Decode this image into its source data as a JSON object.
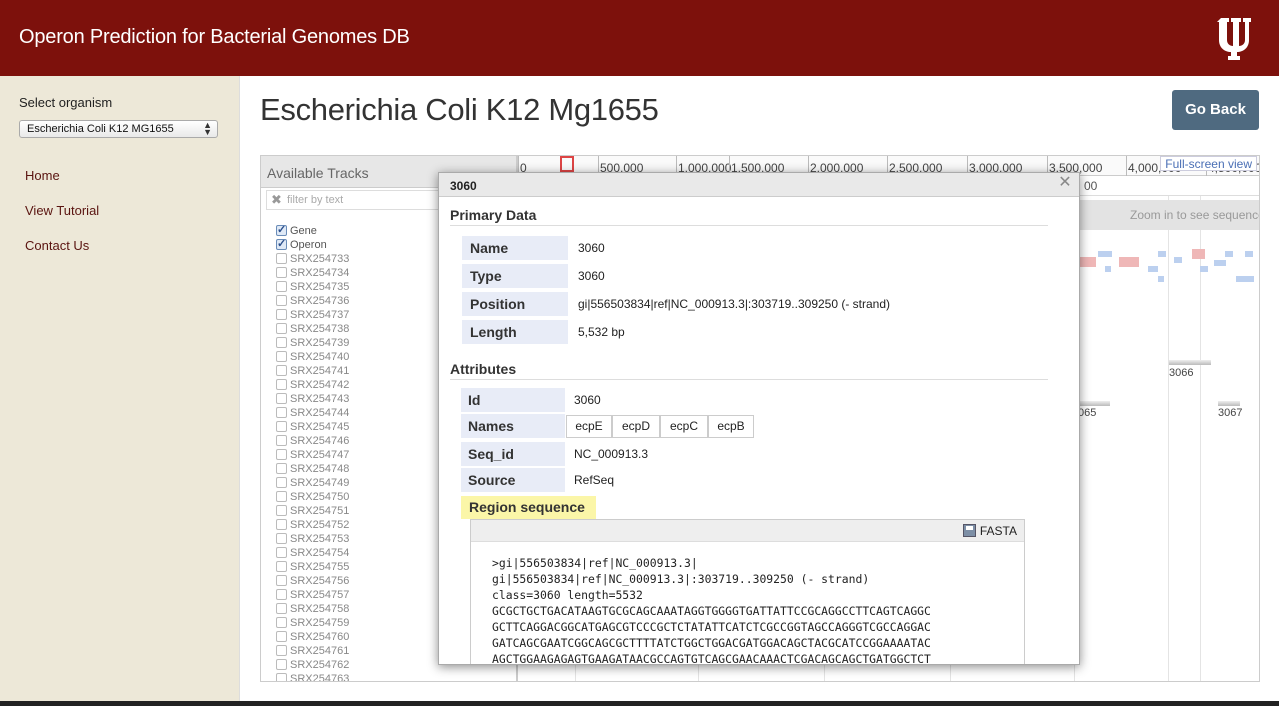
{
  "header": {
    "title": "Operon Prediction for Bacterial Genomes DB",
    "logo": "indiana-university-trident"
  },
  "sidebar": {
    "select_label": "Select organism",
    "selected_organism": "Escherichia Coli K12 MG1655",
    "nav": [
      "Home",
      "View Tutorial",
      "Contact Us"
    ]
  },
  "main": {
    "title": "Escherichia Coli K12 Mg1655",
    "go_back": "Go Back"
  },
  "tracks": {
    "header": "Available Tracks",
    "filter_placeholder": "filter by text",
    "items": [
      {
        "label": "Gene",
        "checked": true
      },
      {
        "label": "Operon",
        "checked": true
      },
      {
        "label": "SRX254733",
        "checked": false
      },
      {
        "label": "SRX254734",
        "checked": false
      },
      {
        "label": "SRX254735",
        "checked": false
      },
      {
        "label": "SRX254736",
        "checked": false
      },
      {
        "label": "SRX254737",
        "checked": false
      },
      {
        "label": "SRX254738",
        "checked": false
      },
      {
        "label": "SRX254739",
        "checked": false
      },
      {
        "label": "SRX254740",
        "checked": false
      },
      {
        "label": "SRX254741",
        "checked": false
      },
      {
        "label": "SRX254742",
        "checked": false
      },
      {
        "label": "SRX254743",
        "checked": false
      },
      {
        "label": "SRX254744",
        "checked": false
      },
      {
        "label": "SRX254745",
        "checked": false
      },
      {
        "label": "SRX254746",
        "checked": false
      },
      {
        "label": "SRX254747",
        "checked": false
      },
      {
        "label": "SRX254748",
        "checked": false
      },
      {
        "label": "SRX254749",
        "checked": false
      },
      {
        "label": "SRX254750",
        "checked": false
      },
      {
        "label": "SRX254751",
        "checked": false
      },
      {
        "label": "SRX254752",
        "checked": false
      },
      {
        "label": "SRX254753",
        "checked": false
      },
      {
        "label": "SRX254754",
        "checked": false
      },
      {
        "label": "SRX254755",
        "checked": false
      },
      {
        "label": "SRX254756",
        "checked": false
      },
      {
        "label": "SRX254757",
        "checked": false
      },
      {
        "label": "SRX254758",
        "checked": false
      },
      {
        "label": "SRX254759",
        "checked": false
      },
      {
        "label": "SRX254760",
        "checked": false
      },
      {
        "label": "SRX254761",
        "checked": false
      },
      {
        "label": "SRX254762",
        "checked": false
      },
      {
        "label": "SRX254763",
        "checked": false
      }
    ]
  },
  "genome_view": {
    "ruler_ticks": [
      "0",
      "500,000",
      "1,000,000",
      "1,500,000",
      "2,000,000",
      "2,500,000",
      "3,000,000",
      "3,500,000",
      "4,000,000",
      "4,500,000"
    ],
    "full_screen_label": "Full-screen view",
    "zoom_hint": "Zoom in to see sequence",
    "secondary_ruler_partial": "00",
    "feature_labels": [
      "3066",
      "065",
      "3067"
    ]
  },
  "dialog": {
    "title": "3060",
    "primary_heading": "Primary Data",
    "primary": [
      {
        "key": "Name",
        "value": "3060"
      },
      {
        "key": "Type",
        "value": "3060"
      },
      {
        "key": "Position",
        "value": "gi|556503834|ref|NC_000913.3|:303719..309250 (- strand)"
      },
      {
        "key": "Length",
        "value": "5,532 bp"
      }
    ],
    "attributes_heading": "Attributes",
    "attr_id": {
      "key": "Id",
      "value": "3060"
    },
    "attr_names": {
      "key": "Names",
      "values": [
        "ecpE",
        "ecpD",
        "ecpC",
        "ecpB"
      ]
    },
    "attr_seqid": {
      "key": "Seq_id",
      "value": "NC_000913.3"
    },
    "attr_source": {
      "key": "Source",
      "value": "RefSeq"
    },
    "region_heading": "Region sequence",
    "fasta_label": "FASTA",
    "sequence_text": ">gi|556503834|ref|NC_000913.3|\ngi|556503834|ref|NC_000913.3|:303719..309250 (- strand)\nclass=3060 length=5532\nGCGCTGCTGACATAAGTGCGCAGCAAATAGGTGGGGTGATTATTCCGCAGGCCTTCAGTCAGGC\nGCTTCAGGACGGCATGAGCGTCCCGCTCTATATTCATCTCGCCGGTAGCCAGGGTCGCCAGGAC\nGATCAGCGAATCGGCAGCGCTTTTATCTGGCTGGACGATGGACAGCTACGCATCCGGAAAATAC\nAGCTGGAAGAGAGTGAAGATAACGCCAGTGTCAGCGAACAAACTCGACAGCAGCTGATGGCTCT"
  },
  "colors": {
    "header_bg": "#7d110c",
    "sidebar_bg": "#ede8d8",
    "button_bg": "#4f6a80",
    "highlight": "#fbf6a8"
  }
}
